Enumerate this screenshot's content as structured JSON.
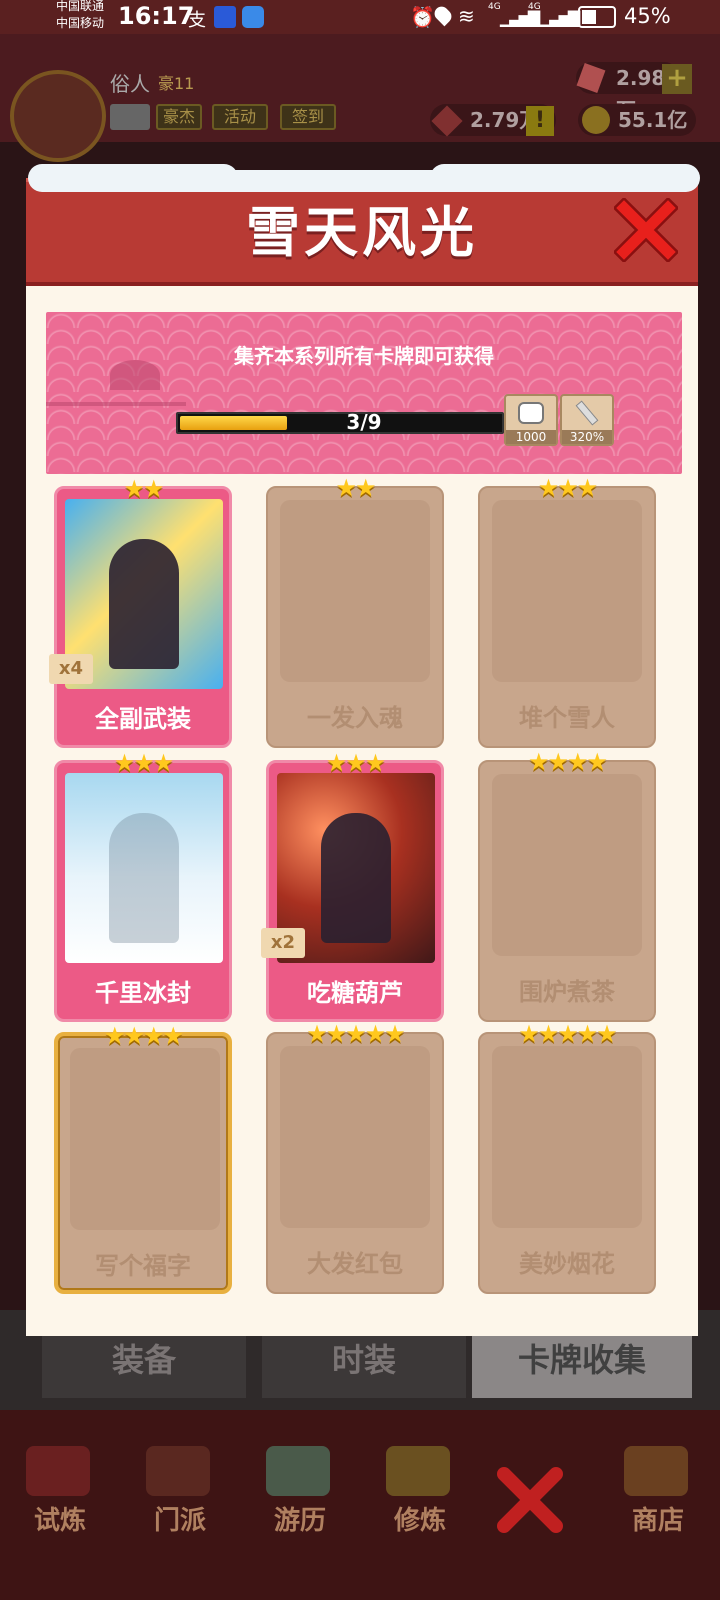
{
  "status_bar": {
    "carrier1": "中国联通",
    "carrier2": "中国移动",
    "time": "16:17",
    "signal1": "4G",
    "signal2": "4G",
    "battery": "45%"
  },
  "header": {
    "player_name": "俗人",
    "player_level": "豪11",
    "buttons": [
      "豪杰",
      "活动",
      "签到"
    ],
    "resources": {
      "gem": "2.98万",
      "coin_red": "2.79万",
      "gold": "55.1亿"
    },
    "add_symbol": "+",
    "alert_symbol": "!"
  },
  "modal": {
    "title": "雪天风光",
    "banner_text": "集齐本系列所有卡牌即可获得",
    "progress": {
      "current": 3,
      "total": 9,
      "label": "3/9",
      "fraction": 0.3333
    },
    "rewards": [
      {
        "icon": "dice-icon",
        "label": "1000"
      },
      {
        "icon": "sword-icon",
        "label": "320%"
      }
    ],
    "cards": [
      {
        "name": "全副武装",
        "stars": "★★",
        "owned": true,
        "count": "x4",
        "frame": "normal"
      },
      {
        "name": "一发入魂",
        "stars": "★★",
        "owned": false,
        "count": "",
        "frame": "normal"
      },
      {
        "name": "堆个雪人",
        "stars": "★★★",
        "owned": false,
        "count": "",
        "frame": "normal"
      },
      {
        "name": "千里冰封",
        "stars": "★★★",
        "owned": true,
        "count": "",
        "frame": "normal"
      },
      {
        "name": "吃糖葫芦",
        "stars": "★★★",
        "owned": true,
        "count": "x2",
        "frame": "normal"
      },
      {
        "name": "围炉煮茶",
        "stars": "★★★★",
        "owned": false,
        "count": "",
        "frame": "normal"
      },
      {
        "name": "写个福字",
        "stars": "★★★★",
        "owned": false,
        "count": "",
        "frame": "gold"
      },
      {
        "name": "大发红包",
        "stars": "★★★★★",
        "owned": false,
        "count": "",
        "frame": "normal"
      },
      {
        "name": "美妙烟花",
        "stars": "★★★★★",
        "owned": false,
        "count": "",
        "frame": "normal"
      }
    ]
  },
  "bottom_tabs": [
    "装备",
    "时装",
    "卡牌收集"
  ],
  "nav": [
    "试炼",
    "门派",
    "游历",
    "修炼",
    "商店"
  ],
  "colors": {
    "accent_red": "#b83a34",
    "pink": "#ec5a86",
    "gold": "#ffc81e",
    "locked": "#c8a68c"
  }
}
